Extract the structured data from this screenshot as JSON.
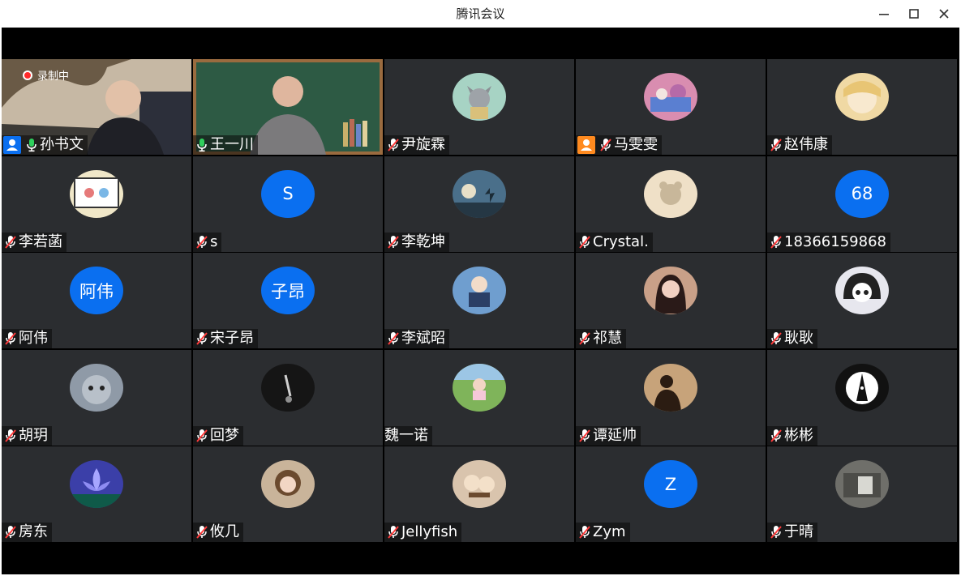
{
  "window": {
    "title": "腾讯会议"
  },
  "recording": {
    "label": "录制中"
  },
  "participants": [
    {
      "name": "孙书文",
      "kind": "video",
      "mic": "on",
      "badge": "host-blue",
      "video_id": "video-1"
    },
    {
      "name": "王一川",
      "kind": "video",
      "mic": "on",
      "video_id": "video-2"
    },
    {
      "name": "尹旋霖",
      "kind": "avatar",
      "mic": "muted",
      "avatar_icon": "cat-avatar",
      "bg": "#a7d3c4"
    },
    {
      "name": "马雯雯",
      "kind": "avatar",
      "mic": "muted",
      "badge": "cohost-orange",
      "avatar_icon": "photo-avatar",
      "bg": "#d98db0"
    },
    {
      "name": "赵伟康",
      "kind": "avatar",
      "mic": "muted",
      "avatar_icon": "anime-avatar",
      "bg": "#f0d9a4"
    },
    {
      "name": "李若菡",
      "kind": "avatar",
      "mic": "muted",
      "avatar_icon": "cartoon-avatar",
      "bg": "#f0e7c8"
    },
    {
      "name": "s",
      "kind": "text",
      "mic": "muted",
      "avatar_text": "S"
    },
    {
      "name": "李乾坤",
      "kind": "avatar",
      "mic": "muted",
      "avatar_icon": "moon-avatar",
      "bg": "#4a6f8a"
    },
    {
      "name": "Crystal.",
      "kind": "avatar",
      "mic": "muted",
      "avatar_icon": "bear-avatar",
      "bg": "#efe0c7"
    },
    {
      "name": "18366159868",
      "kind": "text",
      "mic": "muted",
      "avatar_text": "68"
    },
    {
      "name": "阿伟",
      "kind": "text",
      "mic": "muted",
      "avatar_text": "阿伟"
    },
    {
      "name": "宋子昂",
      "kind": "text",
      "mic": "muted",
      "avatar_text": "子昂"
    },
    {
      "name": "李斌昭",
      "kind": "avatar",
      "mic": "muted",
      "avatar_icon": "anime-boy-avatar",
      "bg": "#6f9ecf"
    },
    {
      "name": "祁慧",
      "kind": "avatar",
      "mic": "muted",
      "avatar_icon": "girl-avatar",
      "bg": "#c9a088"
    },
    {
      "name": "耿耿",
      "kind": "avatar",
      "mic": "muted",
      "avatar_icon": "manga-avatar",
      "bg": "#e7e7ee"
    },
    {
      "name": "胡玥",
      "kind": "avatar",
      "mic": "muted",
      "avatar_icon": "kitten-avatar",
      "bg": "#8f9aa7"
    },
    {
      "name": "回梦",
      "kind": "avatar",
      "mic": "muted",
      "avatar_icon": "dark-avatar",
      "bg": "#151515"
    },
    {
      "name": "魏一诺",
      "kind": "avatar",
      "mic": "none",
      "avatar_icon": "field-avatar",
      "bg": "#7fb45a"
    },
    {
      "name": "谭延帅",
      "kind": "avatar",
      "mic": "muted",
      "avatar_icon": "silhouette-avatar",
      "bg": "#c7a37a"
    },
    {
      "name": "彬彬",
      "kind": "avatar",
      "mic": "muted",
      "avatar_icon": "penguin-avatar",
      "bg": "#111"
    },
    {
      "name": "房东",
      "kind": "avatar",
      "mic": "muted",
      "avatar_icon": "lotus-avatar",
      "bg": "#3b3fa8"
    },
    {
      "name": "攸几",
      "kind": "avatar",
      "mic": "muted",
      "avatar_icon": "doll-avatar",
      "bg": "#c9b49a"
    },
    {
      "name": "Jellyfish",
      "kind": "avatar",
      "mic": "muted",
      "avatar_icon": "food-avatar",
      "bg": "#d9c4ad"
    },
    {
      "name": "Zym",
      "kind": "text",
      "mic": "muted",
      "avatar_text": "Z"
    },
    {
      "name": "于晴",
      "kind": "avatar",
      "mic": "muted",
      "avatar_icon": "street-avatar",
      "bg": "#6f6f6a"
    }
  ],
  "colors": {
    "accent": "#0a6ff0",
    "tile_bg": "#2b2d30",
    "stage_bg": "#000000",
    "cohost": "#ff8a1f"
  }
}
